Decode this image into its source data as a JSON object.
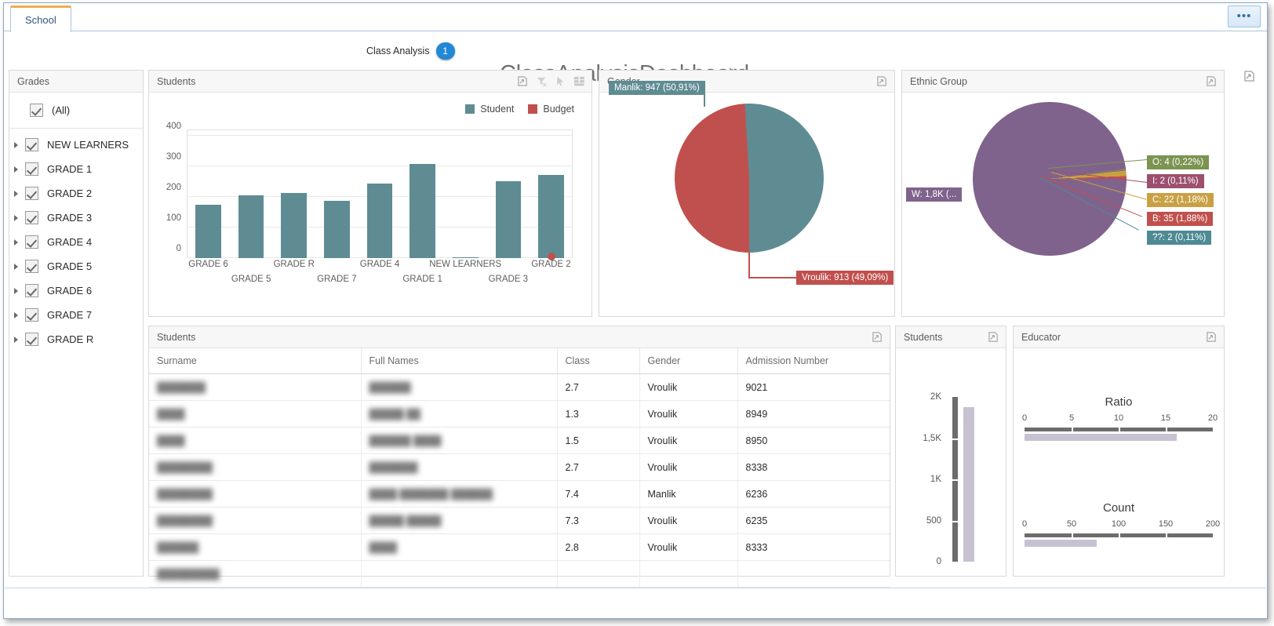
{
  "window": {
    "tab_label": "School",
    "overflow_button": "•••"
  },
  "header": {
    "breadcrumb_label": "Class Analysis",
    "breadcrumb_badge": "1",
    "title": "ClassAnalysisDashboard"
  },
  "grades_panel": {
    "title": "Grades",
    "all_label": "(All)",
    "items": [
      {
        "label": "NEW LEARNERS",
        "checked": true
      },
      {
        "label": "GRADE 1",
        "checked": true
      },
      {
        "label": "GRADE 2",
        "checked": true
      },
      {
        "label": "GRADE 3",
        "checked": true
      },
      {
        "label": "GRADE 4",
        "checked": true
      },
      {
        "label": "GRADE 5",
        "checked": true
      },
      {
        "label": "GRADE 6",
        "checked": true
      },
      {
        "label": "GRADE 7",
        "checked": true
      },
      {
        "label": "GRADE R",
        "checked": true
      }
    ]
  },
  "students_chart_panel": {
    "title": "Students",
    "tools": [
      "export-icon",
      "clear-filter-icon",
      "pointer-icon",
      "grid-icon"
    ]
  },
  "gender_panel": {
    "title": "Gender",
    "tools": [
      "export-icon"
    ],
    "labels": {
      "male": "Manlik: 947 (50,91%)",
      "female": "Vroulik: 913 (49,09%)"
    }
  },
  "ethnic_panel": {
    "title": "Ethnic Group",
    "tools": [
      "export-icon"
    ],
    "labels": {
      "w": "W: 1,8K (...",
      "o": "O: 4 (0,22%)",
      "i": "I: 2 (0,11%)",
      "c": "C: 22 (1,18%)",
      "b": "B: 35 (1,88%)",
      "unknown": "??: 2 (0,11%)"
    }
  },
  "students_table_panel": {
    "title": "Students",
    "tools": [
      "export-icon"
    ],
    "columns": [
      "Surname",
      "Full Names",
      "Class",
      "Gender",
      "Admission Number"
    ],
    "rows": [
      {
        "surname": "███████",
        "full_names": "██████",
        "class": "2.7",
        "gender": "Vroulik",
        "admission_number": "9021"
      },
      {
        "surname": "████",
        "full_names": "█████ ██",
        "class": "1.3",
        "gender": "Vroulik",
        "admission_number": "8949"
      },
      {
        "surname": "████",
        "full_names": "██████ ████",
        "class": "1.5",
        "gender": "Vroulik",
        "admission_number": "8950"
      },
      {
        "surname": "████████",
        "full_names": "███████",
        "class": "2.7",
        "gender": "Vroulik",
        "admission_number": "8338"
      },
      {
        "surname": "████████",
        "full_names": "████ ███████ ██████",
        "class": "7.4",
        "gender": "Manlik",
        "admission_number": "6236"
      },
      {
        "surname": "████████",
        "full_names": "█████ █████",
        "class": "7.3",
        "gender": "Vroulik",
        "admission_number": "6235"
      },
      {
        "surname": "██████",
        "full_names": "████",
        "class": "2.8",
        "gender": "Vroulik",
        "admission_number": "8333"
      },
      {
        "surname": "█████████",
        "full_names": "",
        "class": "",
        "gender": "",
        "admission_number": ""
      }
    ]
  },
  "students_gauge_panel": {
    "title": "Students",
    "tools": [
      "export-icon"
    ],
    "ticks": [
      "2K",
      "1,5K",
      "1K",
      "500",
      "0"
    ],
    "value_fraction": 0.94
  },
  "educator_panel": {
    "title": "Educator",
    "tools": [
      "export-icon"
    ],
    "gauges": [
      {
        "title": "Ratio",
        "ticks": [
          "0",
          "5",
          "10",
          "15",
          "20"
        ],
        "fill_fraction": 0.83
      },
      {
        "title": "Count",
        "ticks": [
          "0",
          "50",
          "100",
          "150",
          "200"
        ],
        "fill_fraction": 0.38
      }
    ]
  },
  "colors": {
    "student": "#5f8c93",
    "budget": "#c0504d",
    "ethnic_w": "#80638c",
    "ethnic_o": "#7b9451",
    "ethnic_i": "#9c4f6e",
    "ethnic_c": "#c9a144",
    "ethnic_b": "#c0504d",
    "ethnic_unknown": "#4e8a93",
    "accent": "#2188d6",
    "tab_accent": "#f0ae4e"
  },
  "chart_data": [
    {
      "type": "bar",
      "title": "Students",
      "categories": [
        "GRADE 6",
        "GRADE 5",
        "GRADE R",
        "GRADE 7",
        "GRADE 4",
        "GRADE 1",
        "NEW LEARNERS",
        "GRADE 3",
        "GRADE 2"
      ],
      "series": [
        {
          "name": "Student",
          "values": [
            173,
            206,
            213,
            188,
            244,
            308,
            3,
            250,
            272
          ]
        },
        {
          "name": "Budget",
          "values": [
            null,
            null,
            null,
            null,
            null,
            null,
            null,
            null,
            0
          ]
        }
      ],
      "legend": [
        "Student",
        "Budget"
      ],
      "yticks": [
        0,
        100,
        200,
        300,
        400
      ],
      "ylim": [
        0,
        420
      ],
      "xlabel": "",
      "ylabel": "",
      "grid": true,
      "legend_position": "top-right"
    },
    {
      "type": "pie",
      "title": "Gender",
      "categories": [
        "Manlik",
        "Vroulik"
      ],
      "values": [
        947,
        913
      ],
      "percentages": [
        50.91,
        49.09
      ],
      "labels": [
        "Manlik: 947 (50,91%)",
        "Vroulik: 913 (49,09%)"
      ],
      "colors": [
        "#5f8c93",
        "#c0504d"
      ]
    },
    {
      "type": "pie",
      "title": "Ethnic Group",
      "categories": [
        "W",
        "O",
        "I",
        "C",
        "B",
        "??"
      ],
      "values": [
        1800,
        4,
        2,
        22,
        35,
        2
      ],
      "percentages": [
        96.5,
        0.22,
        0.11,
        1.18,
        1.88,
        0.11
      ],
      "labels": [
        "W: 1,8K (...",
        "O: 4 (0,22%)",
        "I: 2 (0,11%)",
        "C: 22 (1,18%)",
        "B: 35 (1,88%)",
        "??: 2 (0,11%)"
      ],
      "colors": [
        "#80638c",
        "#7b9451",
        "#9c4f6e",
        "#c9a144",
        "#c0504d",
        "#4e8a93"
      ]
    },
    {
      "type": "bar",
      "title": "Students",
      "orientation": "vertical-gauge",
      "yticks": [
        "0",
        "500",
        "1K",
        "1,5K",
        "2K"
      ],
      "ylim": [
        0,
        2000
      ],
      "values": [
        1880
      ]
    },
    {
      "type": "bar",
      "title": "Ratio",
      "orientation": "horizontal-gauge",
      "xticks": [
        0,
        5,
        10,
        15,
        20
      ],
      "xlim": [
        0,
        20
      ],
      "values": [
        16.6
      ]
    },
    {
      "type": "bar",
      "title": "Count",
      "orientation": "horizontal-gauge",
      "xticks": [
        0,
        50,
        100,
        150,
        200
      ],
      "xlim": [
        0,
        200
      ],
      "values": [
        76
      ]
    }
  ]
}
